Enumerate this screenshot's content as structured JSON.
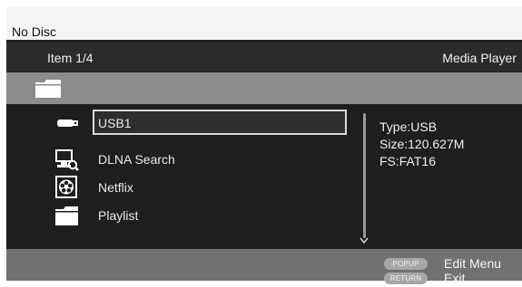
{
  "disc_status": "No Disc",
  "header": {
    "item_count": "Item 1/4",
    "mode": "Media Player"
  },
  "path": {
    "icon": "folder-icon"
  },
  "items": [
    {
      "label": "USB1",
      "icon": "usb-stick-icon",
      "selected": true
    },
    {
      "label": "DLNA Search",
      "icon": "network-search-icon",
      "selected": false
    },
    {
      "label": "Netflix",
      "icon": "film-reel-icon",
      "selected": false
    },
    {
      "label": "Playlist",
      "icon": "folder-icon",
      "selected": false
    }
  ],
  "details": {
    "type": "Type:USB",
    "size": "Size:120.627M",
    "fs": "FS:FAT16"
  },
  "help": {
    "popup": {
      "key": "POPUP",
      "label": "Edit Menu"
    },
    "return": {
      "key": "RETURN",
      "label": "Exit"
    }
  },
  "colors": {
    "background": "#1e1e1e",
    "path_bar": "#8c8c8c",
    "help_bar": "#717171",
    "selection_border": "#d8d8d8"
  }
}
